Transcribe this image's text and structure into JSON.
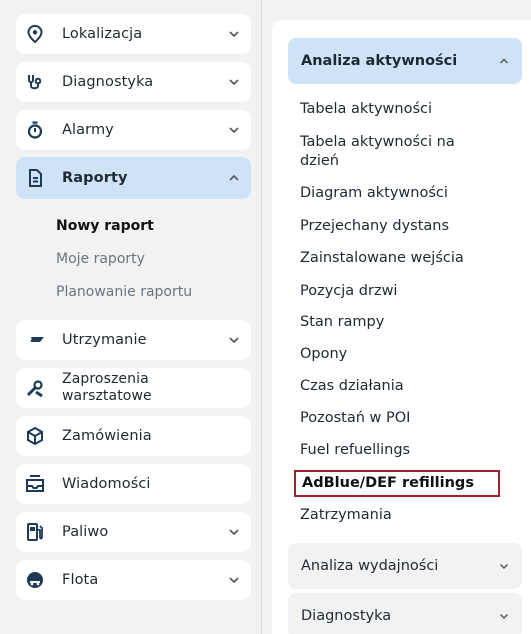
{
  "sidebar": {
    "items": [
      {
        "label": "Lokalizacja",
        "icon": "location-pin-icon"
      },
      {
        "label": "Diagnostyka",
        "icon": "stethoscope-icon"
      },
      {
        "label": "Alarmy",
        "icon": "stopwatch-icon"
      },
      {
        "label": "Raporty",
        "icon": "document-icon"
      },
      {
        "label": "Utrzymanie",
        "icon": "wrench-icon"
      },
      {
        "label": "Zaproszenia warsztatowe",
        "line1": "Zaproszenia",
        "line2": "warsztatowe",
        "icon": "tools-icon"
      },
      {
        "label": "Zamówienia",
        "icon": "box-icon"
      },
      {
        "label": "Wiadomości",
        "icon": "message-icon"
      },
      {
        "label": "Paliwo",
        "icon": "fuel-pump-icon"
      },
      {
        "label": "Flota",
        "icon": "fleet-icon"
      }
    ],
    "raporty_sub": [
      "Nowy raport",
      "Moje raporty",
      "Planowanie raportu"
    ]
  },
  "panel": {
    "open_section": "Analiza aktywności",
    "reports": [
      "Tabela aktywności",
      "Tabela aktywności na dzień",
      "Diagram aktywności",
      "Przejechany dystans",
      "Zainstalowane wejścia",
      "Pozycja drzwi",
      "Stan rampy",
      "Opony",
      "Czas działania",
      "Pozostań w POI",
      "Fuel refuellings",
      "AdBlue/DEF refillings",
      "Zatrzymania"
    ],
    "report_wrap": {
      "line1": "Tabela aktywności na",
      "line2": "dzień"
    },
    "collapsed_sections": [
      "Analiza wydajności",
      "Diagnostyka"
    ]
  },
  "colors": {
    "active_bg": "#cfe3f7",
    "highlight_border": "#a3202b",
    "icon_color": "#1d3a57"
  }
}
